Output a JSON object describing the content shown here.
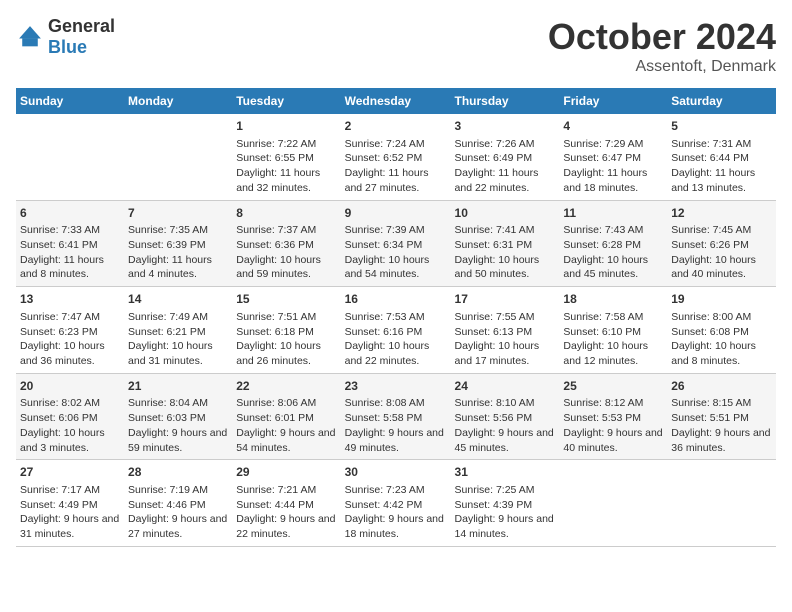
{
  "header": {
    "logo_general": "General",
    "logo_blue": "Blue",
    "month_title": "October 2024",
    "location": "Assentoft, Denmark"
  },
  "days_of_week": [
    "Sunday",
    "Monday",
    "Tuesday",
    "Wednesday",
    "Thursday",
    "Friday",
    "Saturday"
  ],
  "weeks": [
    [
      {
        "day": "",
        "sunrise": "",
        "sunset": "",
        "daylight": ""
      },
      {
        "day": "",
        "sunrise": "",
        "sunset": "",
        "daylight": ""
      },
      {
        "day": "1",
        "sunrise": "Sunrise: 7:22 AM",
        "sunset": "Sunset: 6:55 PM",
        "daylight": "Daylight: 11 hours and 32 minutes."
      },
      {
        "day": "2",
        "sunrise": "Sunrise: 7:24 AM",
        "sunset": "Sunset: 6:52 PM",
        "daylight": "Daylight: 11 hours and 27 minutes."
      },
      {
        "day": "3",
        "sunrise": "Sunrise: 7:26 AM",
        "sunset": "Sunset: 6:49 PM",
        "daylight": "Daylight: 11 hours and 22 minutes."
      },
      {
        "day": "4",
        "sunrise": "Sunrise: 7:29 AM",
        "sunset": "Sunset: 6:47 PM",
        "daylight": "Daylight: 11 hours and 18 minutes."
      },
      {
        "day": "5",
        "sunrise": "Sunrise: 7:31 AM",
        "sunset": "Sunset: 6:44 PM",
        "daylight": "Daylight: 11 hours and 13 minutes."
      }
    ],
    [
      {
        "day": "6",
        "sunrise": "Sunrise: 7:33 AM",
        "sunset": "Sunset: 6:41 PM",
        "daylight": "Daylight: 11 hours and 8 minutes."
      },
      {
        "day": "7",
        "sunrise": "Sunrise: 7:35 AM",
        "sunset": "Sunset: 6:39 PM",
        "daylight": "Daylight: 11 hours and 4 minutes."
      },
      {
        "day": "8",
        "sunrise": "Sunrise: 7:37 AM",
        "sunset": "Sunset: 6:36 PM",
        "daylight": "Daylight: 10 hours and 59 minutes."
      },
      {
        "day": "9",
        "sunrise": "Sunrise: 7:39 AM",
        "sunset": "Sunset: 6:34 PM",
        "daylight": "Daylight: 10 hours and 54 minutes."
      },
      {
        "day": "10",
        "sunrise": "Sunrise: 7:41 AM",
        "sunset": "Sunset: 6:31 PM",
        "daylight": "Daylight: 10 hours and 50 minutes."
      },
      {
        "day": "11",
        "sunrise": "Sunrise: 7:43 AM",
        "sunset": "Sunset: 6:28 PM",
        "daylight": "Daylight: 10 hours and 45 minutes."
      },
      {
        "day": "12",
        "sunrise": "Sunrise: 7:45 AM",
        "sunset": "Sunset: 6:26 PM",
        "daylight": "Daylight: 10 hours and 40 minutes."
      }
    ],
    [
      {
        "day": "13",
        "sunrise": "Sunrise: 7:47 AM",
        "sunset": "Sunset: 6:23 PM",
        "daylight": "Daylight: 10 hours and 36 minutes."
      },
      {
        "day": "14",
        "sunrise": "Sunrise: 7:49 AM",
        "sunset": "Sunset: 6:21 PM",
        "daylight": "Daylight: 10 hours and 31 minutes."
      },
      {
        "day": "15",
        "sunrise": "Sunrise: 7:51 AM",
        "sunset": "Sunset: 6:18 PM",
        "daylight": "Daylight: 10 hours and 26 minutes."
      },
      {
        "day": "16",
        "sunrise": "Sunrise: 7:53 AM",
        "sunset": "Sunset: 6:16 PM",
        "daylight": "Daylight: 10 hours and 22 minutes."
      },
      {
        "day": "17",
        "sunrise": "Sunrise: 7:55 AM",
        "sunset": "Sunset: 6:13 PM",
        "daylight": "Daylight: 10 hours and 17 minutes."
      },
      {
        "day": "18",
        "sunrise": "Sunrise: 7:58 AM",
        "sunset": "Sunset: 6:10 PM",
        "daylight": "Daylight: 10 hours and 12 minutes."
      },
      {
        "day": "19",
        "sunrise": "Sunrise: 8:00 AM",
        "sunset": "Sunset: 6:08 PM",
        "daylight": "Daylight: 10 hours and 8 minutes."
      }
    ],
    [
      {
        "day": "20",
        "sunrise": "Sunrise: 8:02 AM",
        "sunset": "Sunset: 6:06 PM",
        "daylight": "Daylight: 10 hours and 3 minutes."
      },
      {
        "day": "21",
        "sunrise": "Sunrise: 8:04 AM",
        "sunset": "Sunset: 6:03 PM",
        "daylight": "Daylight: 9 hours and 59 minutes."
      },
      {
        "day": "22",
        "sunrise": "Sunrise: 8:06 AM",
        "sunset": "Sunset: 6:01 PM",
        "daylight": "Daylight: 9 hours and 54 minutes."
      },
      {
        "day": "23",
        "sunrise": "Sunrise: 8:08 AM",
        "sunset": "Sunset: 5:58 PM",
        "daylight": "Daylight: 9 hours and 49 minutes."
      },
      {
        "day": "24",
        "sunrise": "Sunrise: 8:10 AM",
        "sunset": "Sunset: 5:56 PM",
        "daylight": "Daylight: 9 hours and 45 minutes."
      },
      {
        "day": "25",
        "sunrise": "Sunrise: 8:12 AM",
        "sunset": "Sunset: 5:53 PM",
        "daylight": "Daylight: 9 hours and 40 minutes."
      },
      {
        "day": "26",
        "sunrise": "Sunrise: 8:15 AM",
        "sunset": "Sunset: 5:51 PM",
        "daylight": "Daylight: 9 hours and 36 minutes."
      }
    ],
    [
      {
        "day": "27",
        "sunrise": "Sunrise: 7:17 AM",
        "sunset": "Sunset: 4:49 PM",
        "daylight": "Daylight: 9 hours and 31 minutes."
      },
      {
        "day": "28",
        "sunrise": "Sunrise: 7:19 AM",
        "sunset": "Sunset: 4:46 PM",
        "daylight": "Daylight: 9 hours and 27 minutes."
      },
      {
        "day": "29",
        "sunrise": "Sunrise: 7:21 AM",
        "sunset": "Sunset: 4:44 PM",
        "daylight": "Daylight: 9 hours and 22 minutes."
      },
      {
        "day": "30",
        "sunrise": "Sunrise: 7:23 AM",
        "sunset": "Sunset: 4:42 PM",
        "daylight": "Daylight: 9 hours and 18 minutes."
      },
      {
        "day": "31",
        "sunrise": "Sunrise: 7:25 AM",
        "sunset": "Sunset: 4:39 PM",
        "daylight": "Daylight: 9 hours and 14 minutes."
      },
      {
        "day": "",
        "sunrise": "",
        "sunset": "",
        "daylight": ""
      },
      {
        "day": "",
        "sunrise": "",
        "sunset": "",
        "daylight": ""
      }
    ]
  ]
}
